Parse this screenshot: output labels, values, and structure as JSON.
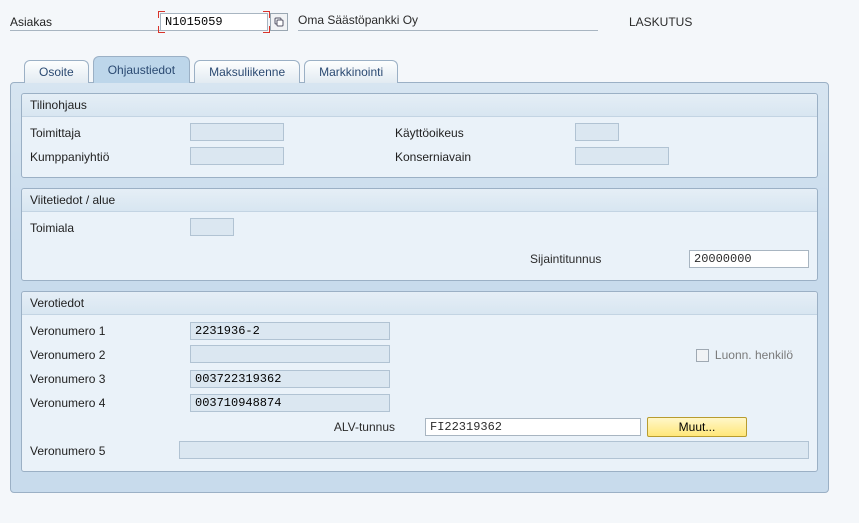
{
  "header": {
    "customer_label": "Asiakas",
    "customer_number": "N1015059",
    "customer_name": "Oma Säästöpankki Oy",
    "billing_type": "LASKUTUS"
  },
  "tabs": {
    "address": "Osoite",
    "control": "Ohjaustiedot",
    "payment": "Maksuliikenne",
    "marketing": "Markkinointi",
    "active": "control"
  },
  "groups": {
    "account": {
      "title": "Tilinohjaus",
      "supplier_label": "Toimittaja",
      "supplier_value": "",
      "authorization_label": "Käyttöoikeus",
      "authorization_value": "",
      "partner_label": "Kumppaniyhtiö",
      "partner_value": "",
      "corpgroup_label": "Konserniavain",
      "corpgroup_value": ""
    },
    "reference": {
      "title": "Viitetiedot / alue",
      "industry_label": "Toimiala",
      "industry_value": "",
      "location_label": "Sijaintitunnus",
      "location_value": "20000000"
    },
    "tax": {
      "title": "Verotiedot",
      "tax1_label": "Veronumero 1",
      "tax1_value": "2231936-2",
      "tax2_label": "Veronumero 2",
      "tax2_value": "",
      "tax3_label": "Veronumero 3",
      "tax3_value": "003722319362",
      "tax4_label": "Veronumero 4",
      "tax4_value": "003710948874",
      "natural_person_label": "Luonn. henkilö",
      "natural_person_checked": false,
      "vat_label": "ALV-tunnus",
      "vat_value": "FI22319362",
      "more_button": "Muut...",
      "tax5_label": "Veronumero 5",
      "tax5_value": ""
    }
  }
}
